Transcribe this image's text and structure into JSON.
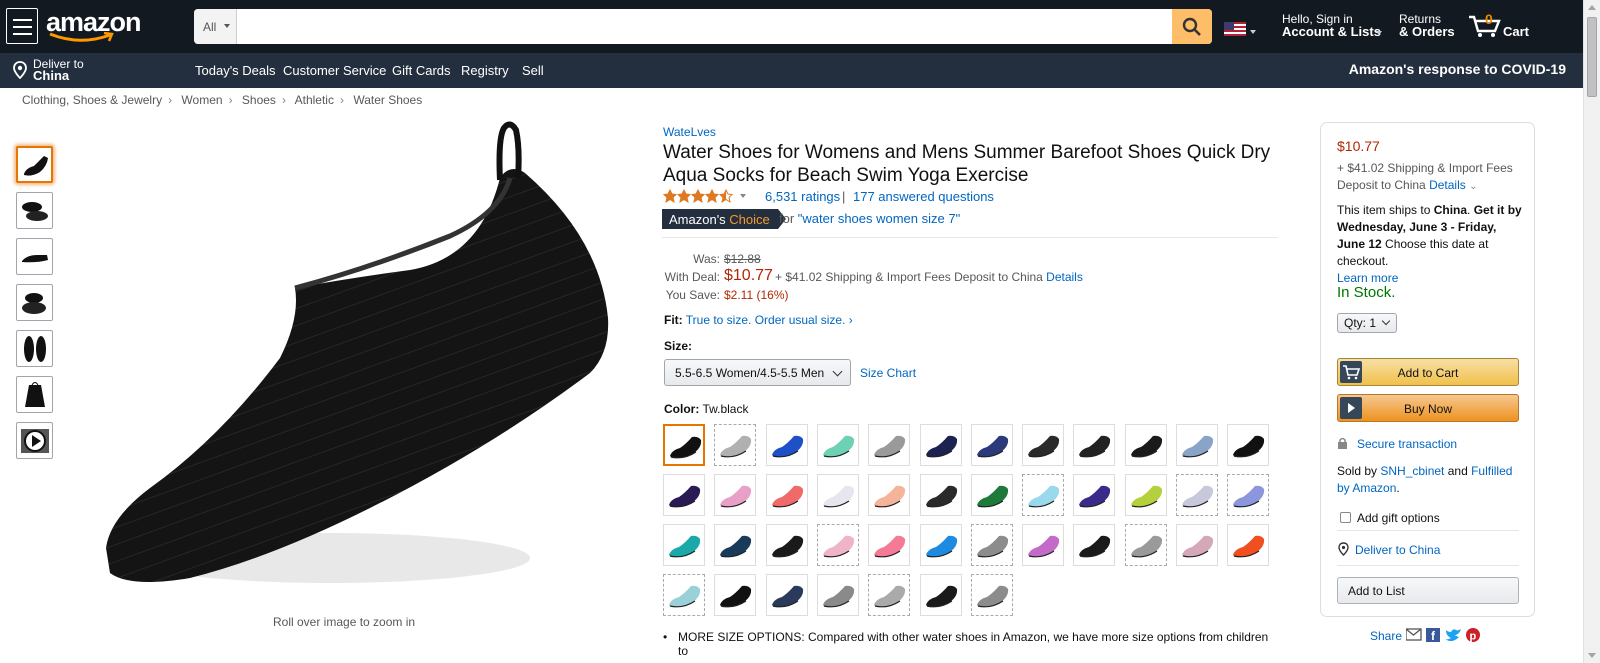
{
  "header": {
    "logo_text": "amazon",
    "search": {
      "department": "All",
      "placeholder": "",
      "value": ""
    },
    "account": {
      "line1": "Hello, Sign in",
      "line2": "Account & Lists"
    },
    "returns": {
      "line1": "Returns",
      "line2": "& Orders"
    },
    "cart": {
      "count": "0",
      "label": "Cart"
    }
  },
  "subnav": {
    "deliver": {
      "line1": "Deliver to",
      "line2": "China"
    },
    "links": [
      "Today's Deals",
      "Customer Service",
      "Gift Cards",
      "Registry",
      "Sell"
    ],
    "covid": "Amazon's response to COVID-19"
  },
  "breadcrumb": [
    "Clothing, Shoes & Jewelry",
    "Women",
    "Shoes",
    "Athletic",
    "Water Shoes"
  ],
  "gallery": {
    "thumbnails": [
      "shoe-side",
      "shoe-pair",
      "shoe-profile",
      "shoe-pair-angle",
      "shoe-sole",
      "shoe-bag",
      "video"
    ],
    "zoom_note": "Roll over image to zoom in"
  },
  "product": {
    "brand": "WateLves",
    "title": "Water Shoes for Womens and Mens Summer Barefoot Shoes Quick Dry Aqua Socks for Beach Swim Yoga Exercise",
    "rating": 4.5,
    "ratings_count": "6,531 ratings",
    "answered": "177 answered questions",
    "choice_prefix": "Amazon's",
    "choice_word": "Choice",
    "choice_for": "for ",
    "choice_query": "\"water shoes women size 7\"",
    "price": {
      "was_label": "Was:",
      "was": "$12.88",
      "deal_label": "With Deal:",
      "deal": "$10.77",
      "shipping": "+ $41.02 Shipping & Import Fees Deposit to China",
      "details": "Details",
      "save_label": "You Save:",
      "save": "$2.11 (16%)"
    },
    "fit_label": "Fit:",
    "fit_text": "True to size. Order usual size. ›",
    "size_label": "Size:",
    "size_value": "5.5-6.5 Women/4.5-5.5 Men",
    "size_chart": "Size Chart",
    "color_label": "Color:",
    "color_value": "Tw.black",
    "bullet": "MORE SIZE OPTIONS: Compared with other water shoes in Amazon, we have more size options from children to"
  },
  "swatches": [
    [
      "#111111",
      "#b0b0b0",
      "#1e50c8",
      "#6fd1b4",
      "#9a9a9a",
      "#1c2350",
      "#2a3a7a",
      "#2a2a2a",
      "#222222",
      "#1a1a1a",
      "#8aa4c8",
      "#111111"
    ],
    [
      "#2a1a55",
      "#e8a0c8",
      "#f06a6a",
      "#e6e6ee",
      "#f4b49a",
      "#2a2a2a",
      "#1d7a3a",
      "#9ad8ec",
      "#3a2a8a",
      "#b4d03c",
      "#c8c8dc",
      "#8c96dc"
    ],
    [
      "#1aa8a8",
      "#1a3a5a",
      "#1a1a1a",
      "#f0b4c8",
      "#f47a96",
      "#1e8ae0",
      "#8c8c8c",
      "#c46ac8",
      "#1a1a1a",
      "#9a9a9a",
      "#d4a8b8",
      "#f05020"
    ],
    [
      "#9ad0d8",
      "#111111",
      "#2a3a5a",
      "#8a8a8a",
      "#aaaaaa",
      "#1a1a1a",
      "#8c8c8c"
    ]
  ],
  "swatch_dashed": [
    [
      false,
      true,
      false,
      false,
      false,
      false,
      false,
      false,
      false,
      false,
      false,
      false
    ],
    [
      false,
      false,
      false,
      false,
      false,
      false,
      false,
      true,
      false,
      false,
      true,
      true
    ],
    [
      false,
      false,
      false,
      true,
      false,
      false,
      true,
      false,
      false,
      true,
      false,
      false
    ],
    [
      true,
      false,
      false,
      false,
      true,
      false,
      true
    ]
  ],
  "buybox": {
    "price": "$10.77",
    "shipping": "+ $41.02 Shipping & Import Fees Deposit to China",
    "details": "Details",
    "ships_pre": "This item ships to ",
    "ships_country": "China",
    "ships_mid": ". ",
    "get_it": "Get it by Wednesday, June 3 - Friday, June 12",
    "ships_post": " Choose this date at checkout.",
    "learn_more": "Learn more",
    "stock": "In Stock.",
    "qty": "Qty: 1",
    "add_to_cart": "Add to Cart",
    "buy_now": "Buy Now",
    "secure": "Secure transaction",
    "sold_pre": "Sold by ",
    "seller": "SNH_cbinet",
    "sold_and": " and ",
    "fulfilled": "Fulfilled by Amazon",
    "sold_end": ".",
    "gift": "Add gift options",
    "deliver": "Deliver to China",
    "add_list": "Add to List",
    "share": "Share"
  },
  "colors": {
    "nav_dark": "#131921",
    "nav_sub": "#232f3e",
    "link": "#0066c0",
    "price": "#b12704",
    "stock": "#007600",
    "accent": "#febd69"
  }
}
